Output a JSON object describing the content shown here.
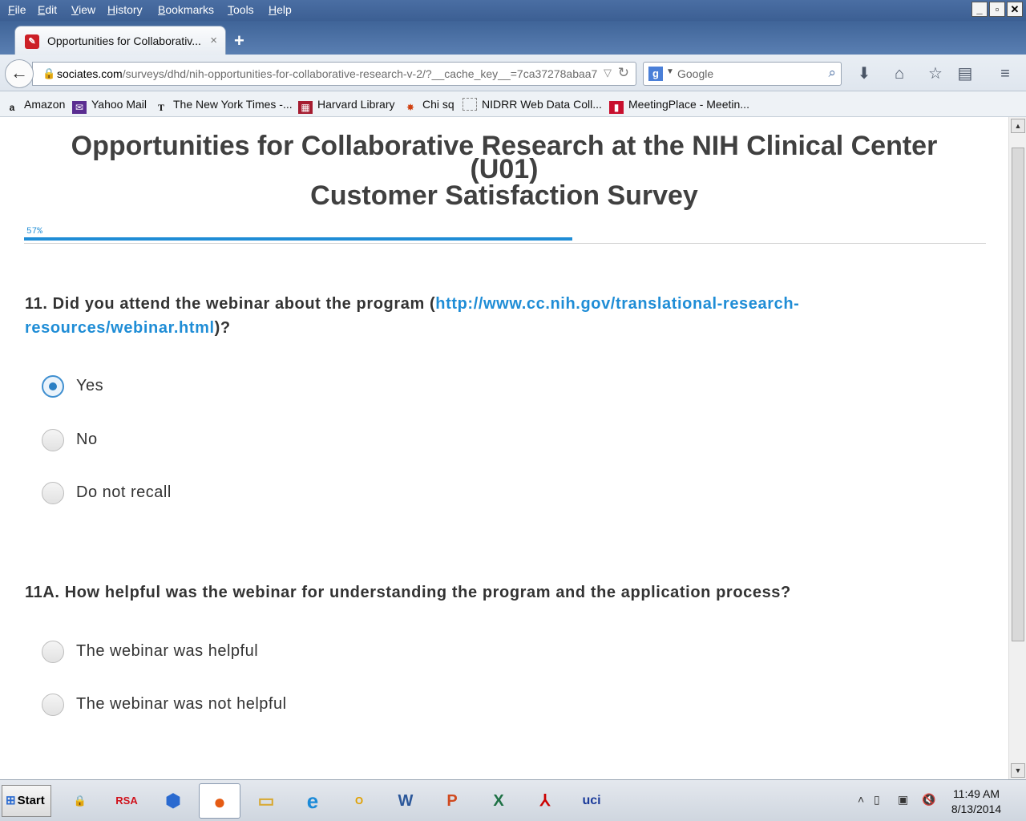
{
  "menu": [
    "File",
    "Edit",
    "View",
    "History",
    "Bookmarks",
    "Tools",
    "Help"
  ],
  "window_buttons": {
    "minimize": "_",
    "restore": "▫",
    "close": "✕"
  },
  "tab": {
    "title": "Opportunities for Collaborativ...",
    "close": "×",
    "new_tab": "+"
  },
  "url": {
    "prefix": "sociates.com",
    "rest": "/surveys/dhd/nih-opportunities-for-collaborative-research-v-2/?__cache_key__=7ca37278abaa7"
  },
  "search": {
    "placeholder": "Google"
  },
  "bookmarks": [
    {
      "label": "Amazon",
      "icon": "amazon-icon"
    },
    {
      "label": "Yahoo Mail",
      "icon": "yahoo-mail-icon"
    },
    {
      "label": "The New York Times -...",
      "icon": "nyt-icon"
    },
    {
      "label": "Harvard Library",
      "icon": "harvard-icon"
    },
    {
      "label": "Chi sq",
      "icon": "chi-sq-icon"
    },
    {
      "label": "NIDRR Web Data Coll...",
      "icon": "blank-page-icon"
    },
    {
      "label": "MeetingPlace - Meetin...",
      "icon": "meetingplace-icon"
    }
  ],
  "survey": {
    "title_line1": "Opportunities for Collaborative Research at the NIH Clinical Center",
    "title_line2": "(U01)",
    "title_line3": "Customer Satisfaction Survey",
    "progress_label": "57%",
    "progress": 0.57,
    "q11": {
      "prefix": "11. Did you attend the webinar about the program (",
      "link": "http://www.cc.nih.gov/translational-research-resources/webinar.html",
      "suffix": ")?",
      "options": [
        "Yes",
        "No",
        "Do not recall"
      ],
      "selected": "Yes"
    },
    "q11a": {
      "text": "11A. How helpful was the webinar for understanding the program and the application process?",
      "options": [
        "The webinar was helpful",
        "The webinar was not helpful"
      ]
    }
  },
  "taskbar": {
    "start_label": "Start",
    "rsa_label": "RSA",
    "clock_time": "11:49 AM",
    "clock_date": "8/13/2014"
  }
}
